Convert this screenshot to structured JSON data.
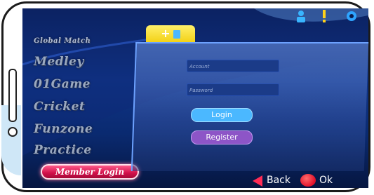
{
  "menu": {
    "items": [
      {
        "label": "Global Match"
      },
      {
        "label": "Medley"
      },
      {
        "label": "01Game"
      },
      {
        "label": "Cricket"
      },
      {
        "label": "Funzone"
      },
      {
        "label": "Practice"
      }
    ],
    "selected": "Member Login"
  },
  "login": {
    "account_placeholder": "Account",
    "password_placeholder": "Password",
    "login_label": "Login",
    "register_label": "Register"
  },
  "nav": {
    "back_label": "Back",
    "ok_label": "Ok"
  },
  "tab": {
    "plus": "+"
  },
  "icons": {
    "top": [
      "person-icon",
      "exclamation-icon",
      "gear-icon"
    ],
    "back": "back-arrow-icon",
    "ok": "ok-circle-icon",
    "tab": "book-icon"
  },
  "colors": {
    "selected_menu": "#d1104a",
    "login_button": "#4bb8ff",
    "register_button": "#8d55c7",
    "tab": "#f2cf10"
  }
}
